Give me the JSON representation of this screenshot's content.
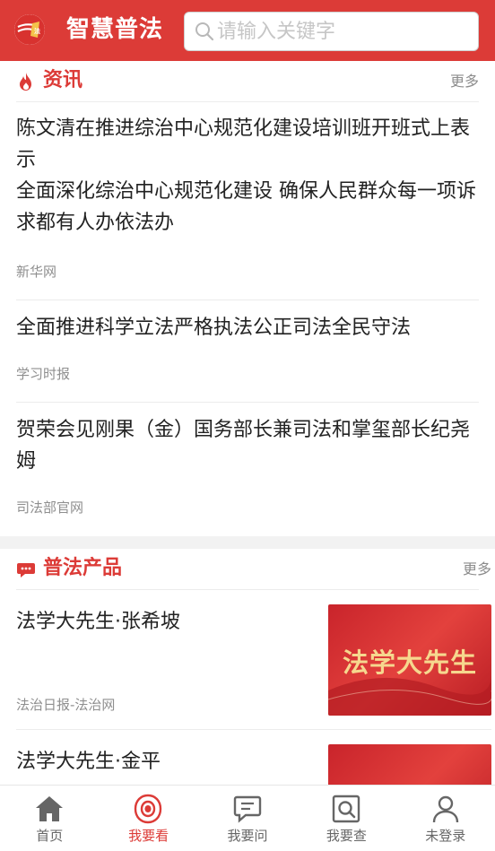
{
  "header": {
    "app_title": "智慧普法",
    "search_placeholder": "请输入关键字",
    "brand_color": "#dc3b37"
  },
  "news": {
    "section_title": "资讯",
    "more_label": "更多",
    "items": [
      {
        "title": "陈文清在推进综治中心规范化建设培训班开班式上表示\n全面深化综治中心规范化建设 确保人民群众每一项诉求都有人办依法办",
        "source": "新华网"
      },
      {
        "title": "全面推进科学立法严格执法公正司法全民守法",
        "source": "学习时报"
      },
      {
        "title": "贺荣会见刚果（金）国务部长兼司法和掌玺部长纪尧姆",
        "source": "司法部官网"
      }
    ]
  },
  "products": {
    "section_title": "普法产品",
    "more_label": "更多",
    "items": [
      {
        "title": "法学大先生·张希坡",
        "source": "法治日报-法治网",
        "thumb_text": "法学大先生"
      },
      {
        "title": "法学大先生·金平",
        "source": "",
        "thumb_text": ""
      }
    ]
  },
  "tabbar": {
    "items": [
      {
        "label": "首页",
        "icon": "home-icon",
        "active": false
      },
      {
        "label": "我要看",
        "icon": "watch-icon",
        "active": true
      },
      {
        "label": "我要问",
        "icon": "chat-icon",
        "active": false
      },
      {
        "label": "我要查",
        "icon": "lookup-icon",
        "active": false
      },
      {
        "label": "未登录",
        "icon": "user-icon",
        "active": false
      }
    ]
  }
}
